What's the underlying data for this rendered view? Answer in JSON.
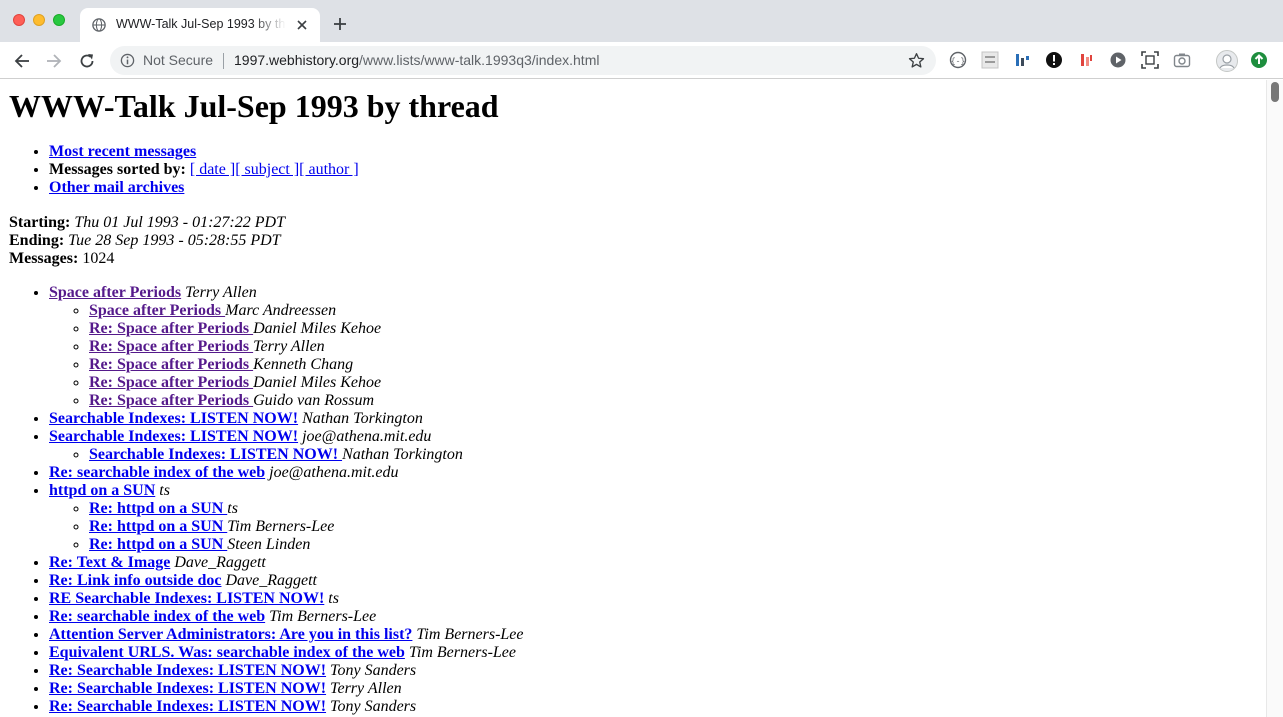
{
  "browser": {
    "tab_title": "WWW-Talk Jul-Sep 1993 by thread",
    "security_label": "Not Secure",
    "url_host": "1997.webhistory.org",
    "url_path": "/www.lists/www-talk.1993q3/index.html"
  },
  "page": {
    "heading": "WWW-Talk Jul-Sep 1993 by thread",
    "nav": {
      "recent": "Most recent messages",
      "sorted_label": "Messages sorted by:",
      "date": "[ date ]",
      "subject": "[ subject ]",
      "author": "[ author ]",
      "archives": "Other mail archives"
    },
    "meta": {
      "starting_label": "Starting:",
      "starting": "Thu 01 Jul 1993 - 01:27:22 PDT",
      "ending_label": "Ending:",
      "ending": "Tue 28 Sep 1993 - 05:28:55 PDT",
      "messages_label": "Messages:",
      "messages": "1024"
    },
    "threads": [
      {
        "title": "Space after Periods",
        "author": "Terry Allen",
        "visited": true,
        "replies": [
          {
            "title": "Space after Periods ",
            "author": "Marc Andreessen",
            "visited": true
          },
          {
            "title": "Re: Space after Periods ",
            "author": "Daniel Miles Kehoe",
            "visited": true
          },
          {
            "title": "Re: Space after Periods ",
            "author": "Terry Allen",
            "visited": true
          },
          {
            "title": "Re: Space after Periods ",
            "author": "Kenneth Chang",
            "visited": true
          },
          {
            "title": "Re: Space after Periods ",
            "author": "Daniel Miles Kehoe",
            "visited": true
          },
          {
            "title": "Re: Space after Periods ",
            "author": "Guido van Rossum",
            "visited": true
          }
        ]
      },
      {
        "title": "Searchable Indexes: LISTEN NOW!",
        "author": "Nathan Torkington",
        "replies": []
      },
      {
        "title": "Searchable Indexes: LISTEN NOW!",
        "author": "joe@athena.mit.edu",
        "replies": [
          {
            "title": "Searchable Indexes: LISTEN NOW! ",
            "author": "Nathan Torkington"
          }
        ]
      },
      {
        "title": "Re: searchable index of the web",
        "author": "joe@athena.mit.edu",
        "replies": []
      },
      {
        "title": "httpd on a SUN",
        "author": "ts",
        "replies": [
          {
            "title": "Re: httpd on a SUN ",
            "author": "ts"
          },
          {
            "title": "Re: httpd on a SUN ",
            "author": "Tim Berners-Lee"
          },
          {
            "title": "Re: httpd on a SUN ",
            "author": "Steen Linden"
          }
        ]
      },
      {
        "title": "Re: Text & Image",
        "author": "Dave_Raggett",
        "replies": []
      },
      {
        "title": "Re: Link info outside doc",
        "author": "Dave_Raggett",
        "replies": []
      },
      {
        "title": "RE Searchable Indexes: LISTEN NOW!",
        "author": "ts",
        "replies": []
      },
      {
        "title": "Re: searchable index of the web",
        "author": "Tim Berners-Lee",
        "replies": []
      },
      {
        "title": "Attention Server Administrators: Are you in this list?",
        "author": "Tim Berners-Lee",
        "replies": []
      },
      {
        "title": "Equivalent URLS. Was: searchable index of the web",
        "author": "Tim Berners-Lee",
        "replies": []
      },
      {
        "title": "Re: Searchable Indexes: LISTEN NOW!",
        "author": "Tony Sanders",
        "replies": []
      },
      {
        "title": "Re: Searchable Indexes: LISTEN NOW!",
        "author": "Terry Allen",
        "replies": []
      },
      {
        "title": "Re: Searchable Indexes: LISTEN NOW!",
        "author": "Tony Sanders",
        "replies": []
      }
    ]
  }
}
